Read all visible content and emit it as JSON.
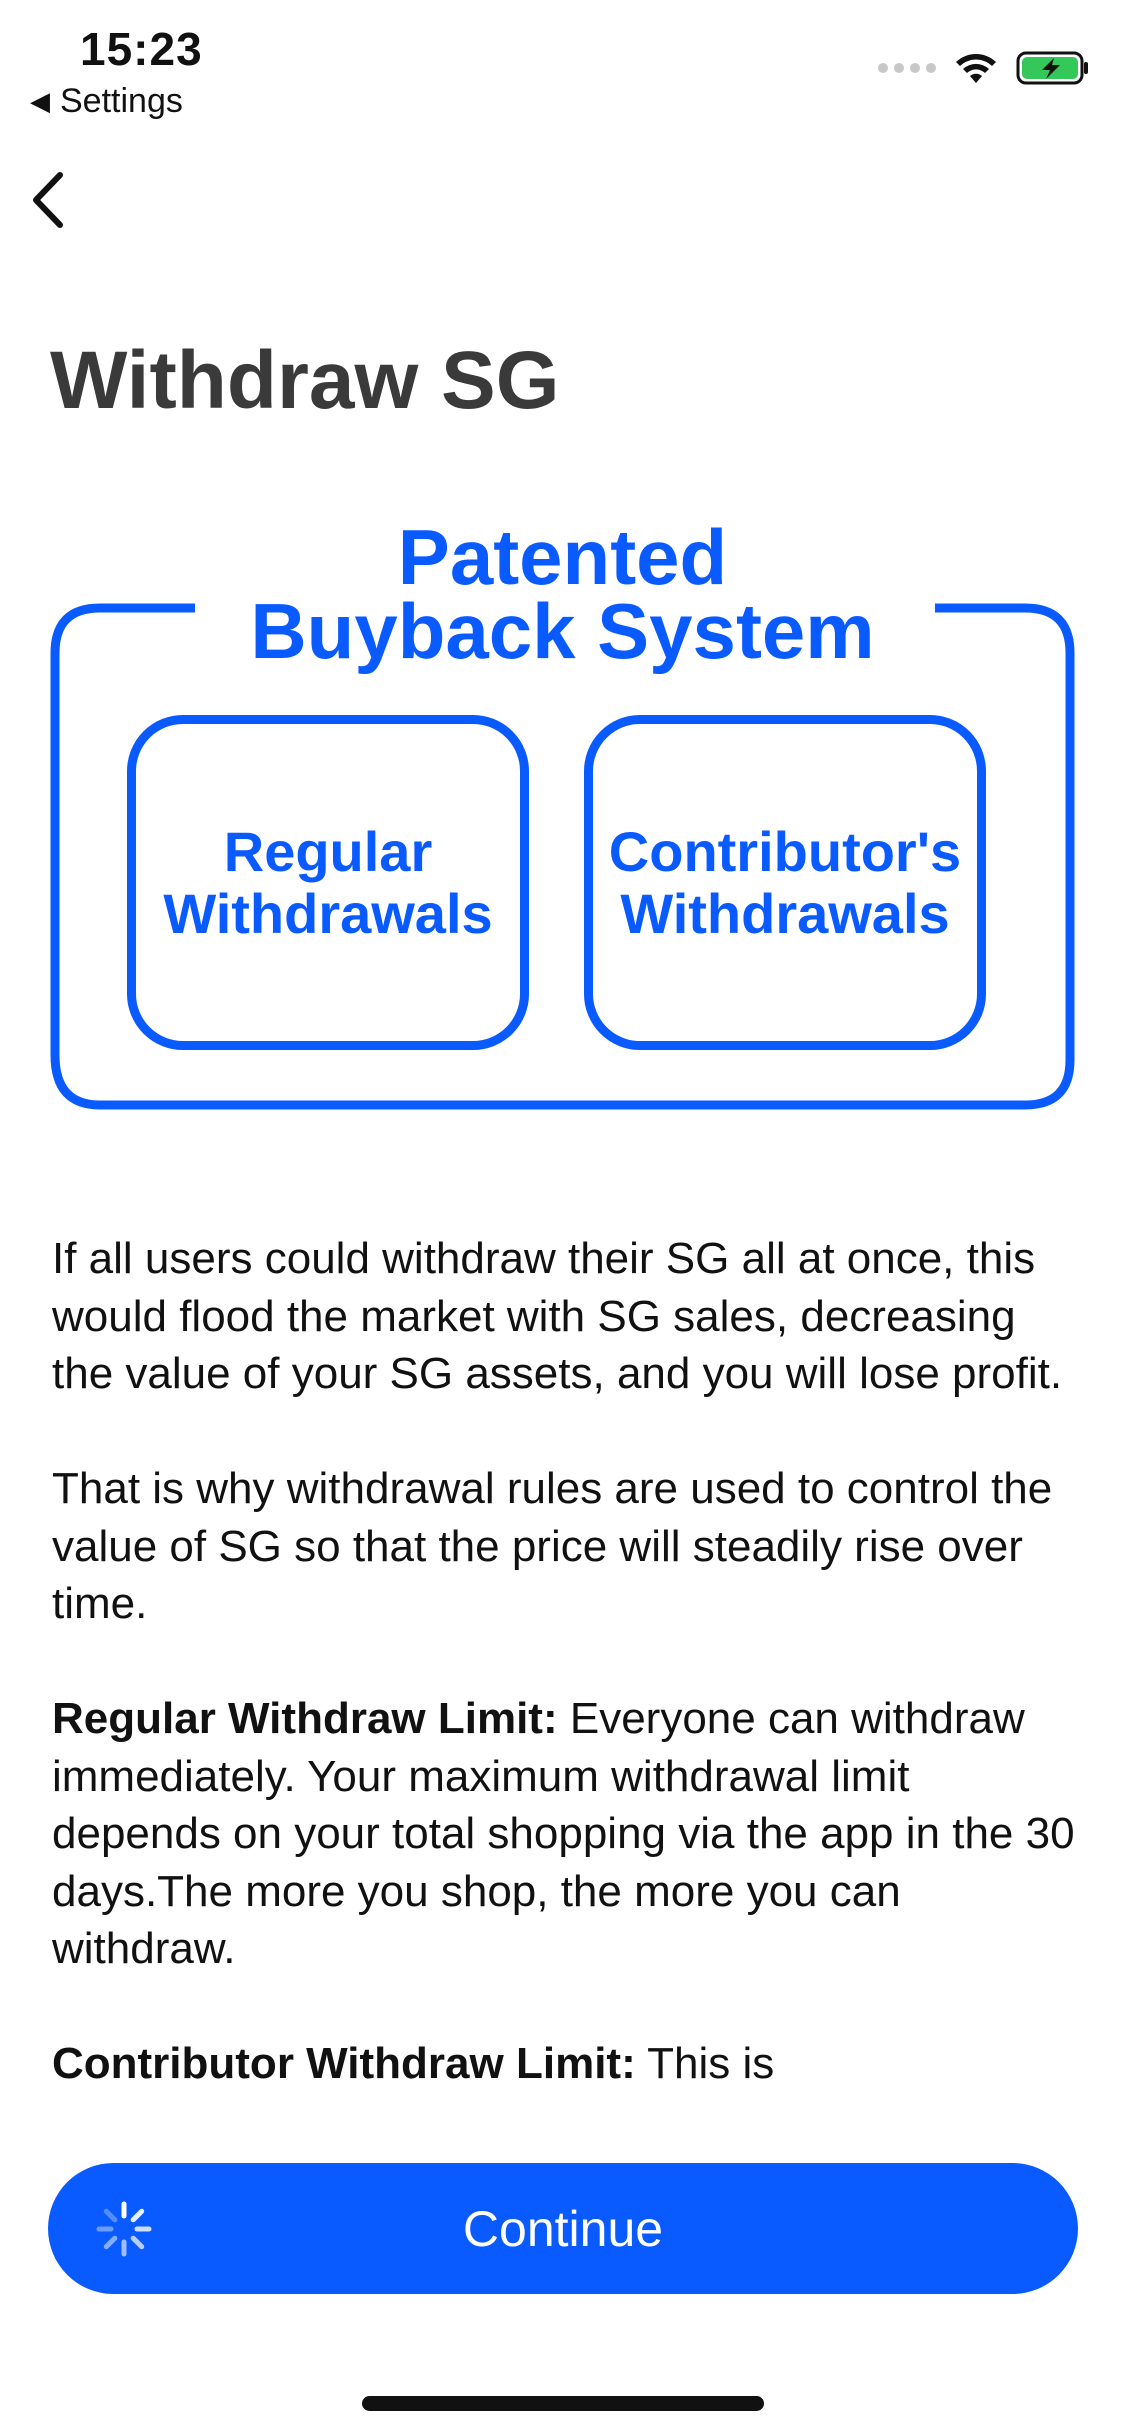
{
  "status_bar": {
    "time": "15:23",
    "back_app": "Settings",
    "icons": [
      "signal-icon",
      "wifi-icon",
      "battery-charging-icon"
    ]
  },
  "nav": {
    "back_icon": "chevron-left-icon"
  },
  "page": {
    "title": "Withdraw SG"
  },
  "diagram": {
    "heading_line1": "Patented",
    "heading_line2": "Buyback System",
    "cards": [
      {
        "line1": "Regular",
        "line2": "Withdrawals"
      },
      {
        "line1": "Contributor's",
        "line2": "Withdrawals"
      }
    ],
    "color": "#0a5bff"
  },
  "body": {
    "p1": "If all users could withdraw their SG all at once, this would flood the market with SG sales, decreasing the value of your SG assets, and you will lose profit.",
    "p2": "That is why withdrawal rules are used to control the value of SG so that the price will steadily rise over time.",
    "p3_bold": "Regular Withdraw Limit:",
    "p3_text": " Everyone can withdraw immediately. Your maximum withdrawal limit depends on your total shopping via the app in the 30 days.The more you shop, the more you can withdraw.",
    "p4_bold": "Contributor Withdraw Limit:",
    "p4_text": " This is"
  },
  "footer": {
    "continue_label": "Continue",
    "accent": "#0a5bff"
  }
}
